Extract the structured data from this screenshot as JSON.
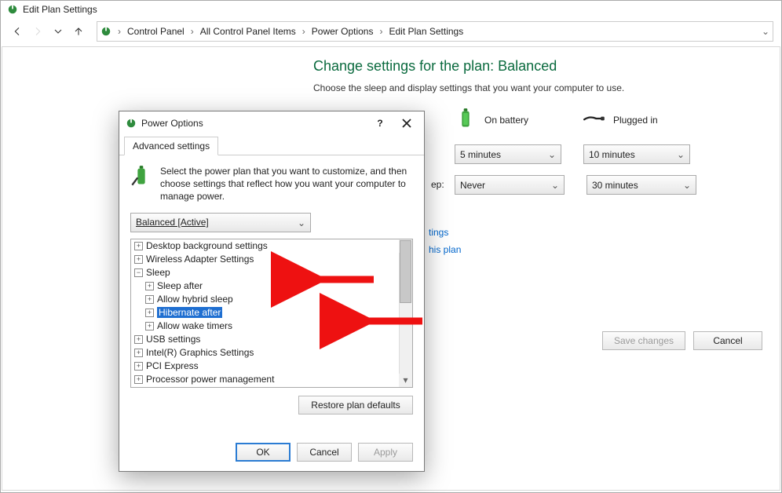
{
  "window": {
    "title": "Edit Plan Settings"
  },
  "nav": {
    "crumbs": [
      "Control Panel",
      "All Control Panel Items",
      "Power Options",
      "Edit Plan Settings"
    ]
  },
  "main": {
    "heading": "Change settings for the plan: Balanced",
    "subtext": "Choose the sleep and display settings that you want your computer to use.",
    "col_battery": "On battery",
    "col_plugged": "Plugged in",
    "row_sleep_label": "ep:",
    "display_battery": "5 minutes",
    "display_plugged": "10 minutes",
    "sleep_battery": "Never",
    "sleep_plugged": "30 minutes",
    "link1_tail": "tings",
    "link2_tail": "his plan",
    "save_btn": "Save changes",
    "cancel_btn": "Cancel"
  },
  "dialog": {
    "title": "Power Options",
    "tab": "Advanced settings",
    "desc": "Select the power plan that you want to customize, and then choose settings that reflect how you want your computer to manage power.",
    "plan": "Balanced [Active]",
    "tree": [
      {
        "lvl": 0,
        "exp": "+",
        "label": "Desktop background settings"
      },
      {
        "lvl": 0,
        "exp": "+",
        "label": "Wireless Adapter Settings"
      },
      {
        "lvl": 0,
        "exp": "−",
        "label": "Sleep"
      },
      {
        "lvl": 1,
        "exp": "+",
        "label": "Sleep after"
      },
      {
        "lvl": 1,
        "exp": "+",
        "label": "Allow hybrid sleep"
      },
      {
        "lvl": 1,
        "exp": "+",
        "label": "Hibernate after",
        "selected": true
      },
      {
        "lvl": 1,
        "exp": "+",
        "label": "Allow wake timers"
      },
      {
        "lvl": 0,
        "exp": "+",
        "label": "USB settings"
      },
      {
        "lvl": 0,
        "exp": "+",
        "label": "Intel(R) Graphics Settings"
      },
      {
        "lvl": 0,
        "exp": "+",
        "label": "PCI Express"
      },
      {
        "lvl": 0,
        "exp": "+",
        "label": "Processor power management"
      }
    ],
    "restore": "Restore plan defaults",
    "ok": "OK",
    "cancel": "Cancel",
    "apply": "Apply"
  }
}
